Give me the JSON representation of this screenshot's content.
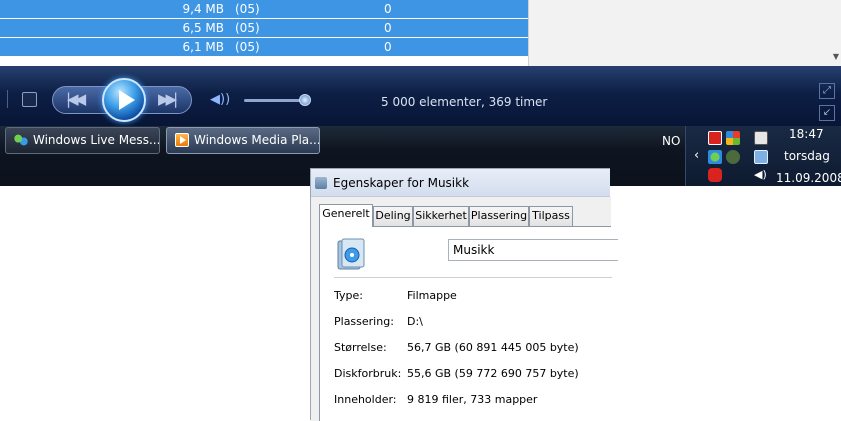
{
  "list": {
    "rows": [
      {
        "size": "9,4 MB",
        "num": "(05)",
        "count": "0"
      },
      {
        "size": "6,5 MB",
        "num": "(05)",
        "count": "0"
      },
      {
        "size": "6,1 MB",
        "num": "(05)",
        "count": "0"
      }
    ]
  },
  "player": {
    "status": "5 000 elementer, 369 timer",
    "volume_level": 0.9
  },
  "taskbar": {
    "buttons": [
      {
        "label": "Windows Live Mess...",
        "icon": "msn-icon"
      },
      {
        "label": "Windows Media Pla...",
        "icon": "wmp-icon"
      }
    ],
    "language": "NO",
    "clock": {
      "time": "18:47",
      "day": "torsdag",
      "date": "11.09.2008"
    }
  },
  "dialog": {
    "title": "Egenskaper for Musikk",
    "tabs": [
      "Generelt",
      "Deling",
      "Sikkerhet",
      "Plassering",
      "Tilpass"
    ],
    "name_value": "Musikk",
    "properties": [
      {
        "label": "Type:",
        "value": "Filmappe"
      },
      {
        "label": "Plassering:",
        "value": "D:\\"
      },
      {
        "label": "Størrelse:",
        "value": "56,7 GB (60 891 445 005 byte)"
      },
      {
        "label": "Diskforbruk:",
        "value": "55,6 GB (59 772 690 757 byte)"
      },
      {
        "label": "Inneholder:",
        "value": "9 819 filer, 733 mapper"
      }
    ]
  },
  "colors": {
    "selection": "#3d95e4",
    "player_bg": "#0d1f45",
    "taskbar_bg": "#0e1520"
  }
}
